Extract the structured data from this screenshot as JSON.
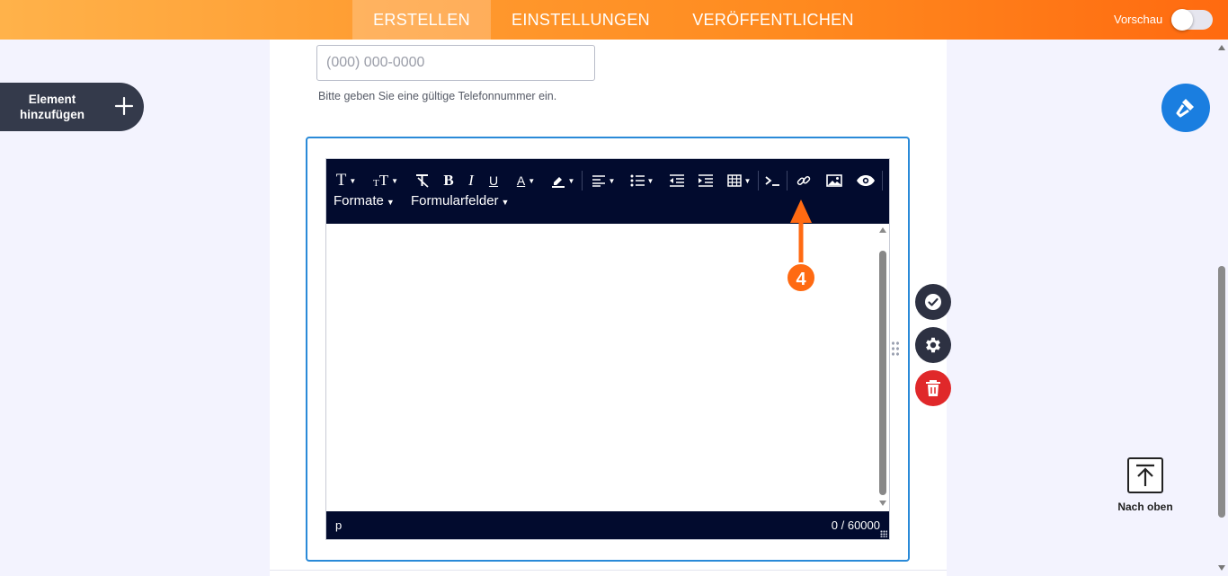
{
  "topbar": {
    "tabs": [
      {
        "label": "ERSTELLEN",
        "active": true
      },
      {
        "label": "EINSTELLUNGEN",
        "active": false
      },
      {
        "label": "VERÖFFENTLICHEN",
        "active": false
      }
    ],
    "preview_label": "Vorschau",
    "preview_enabled": false
  },
  "sidebar": {
    "add_element_label": "Element hinzufügen",
    "add_icon": "plus-icon"
  },
  "phone_field": {
    "placeholder": "(000) 000-0000",
    "value": "",
    "hint": "Bitte geben Sie eine gültige Telefonnummer ein."
  },
  "editor": {
    "toolbar_icons": [
      "font-family-icon",
      "font-size-icon",
      "clear-format-icon",
      "bold-icon",
      "italic-icon",
      "underline-icon",
      "text-color-icon",
      "highlight-icon",
      "align-icon",
      "bullet-list-icon",
      "outdent-icon",
      "indent-icon",
      "table-icon",
      "code-icon",
      "link-icon",
      "image-icon",
      "preview-icon"
    ],
    "formats_label": "Formate",
    "form_fields_label": "Formularfelder",
    "content": "",
    "status_path": "p",
    "char_count": "0 / 60000"
  },
  "annotation": {
    "step_number": "4",
    "color": "#ff6a12"
  },
  "field_actions": [
    "check-icon",
    "gear-icon",
    "trash-icon"
  ],
  "right_panel": {
    "designer_icon": "paint-roller-icon",
    "back_to_top_label": "Nach oben"
  },
  "colors": {
    "accent": "#ff8a1f",
    "toolbar_bg": "#020b2e",
    "selection_border": "#2a8ad8",
    "delete": "#e0282a",
    "fab": "#1a7ee0"
  }
}
